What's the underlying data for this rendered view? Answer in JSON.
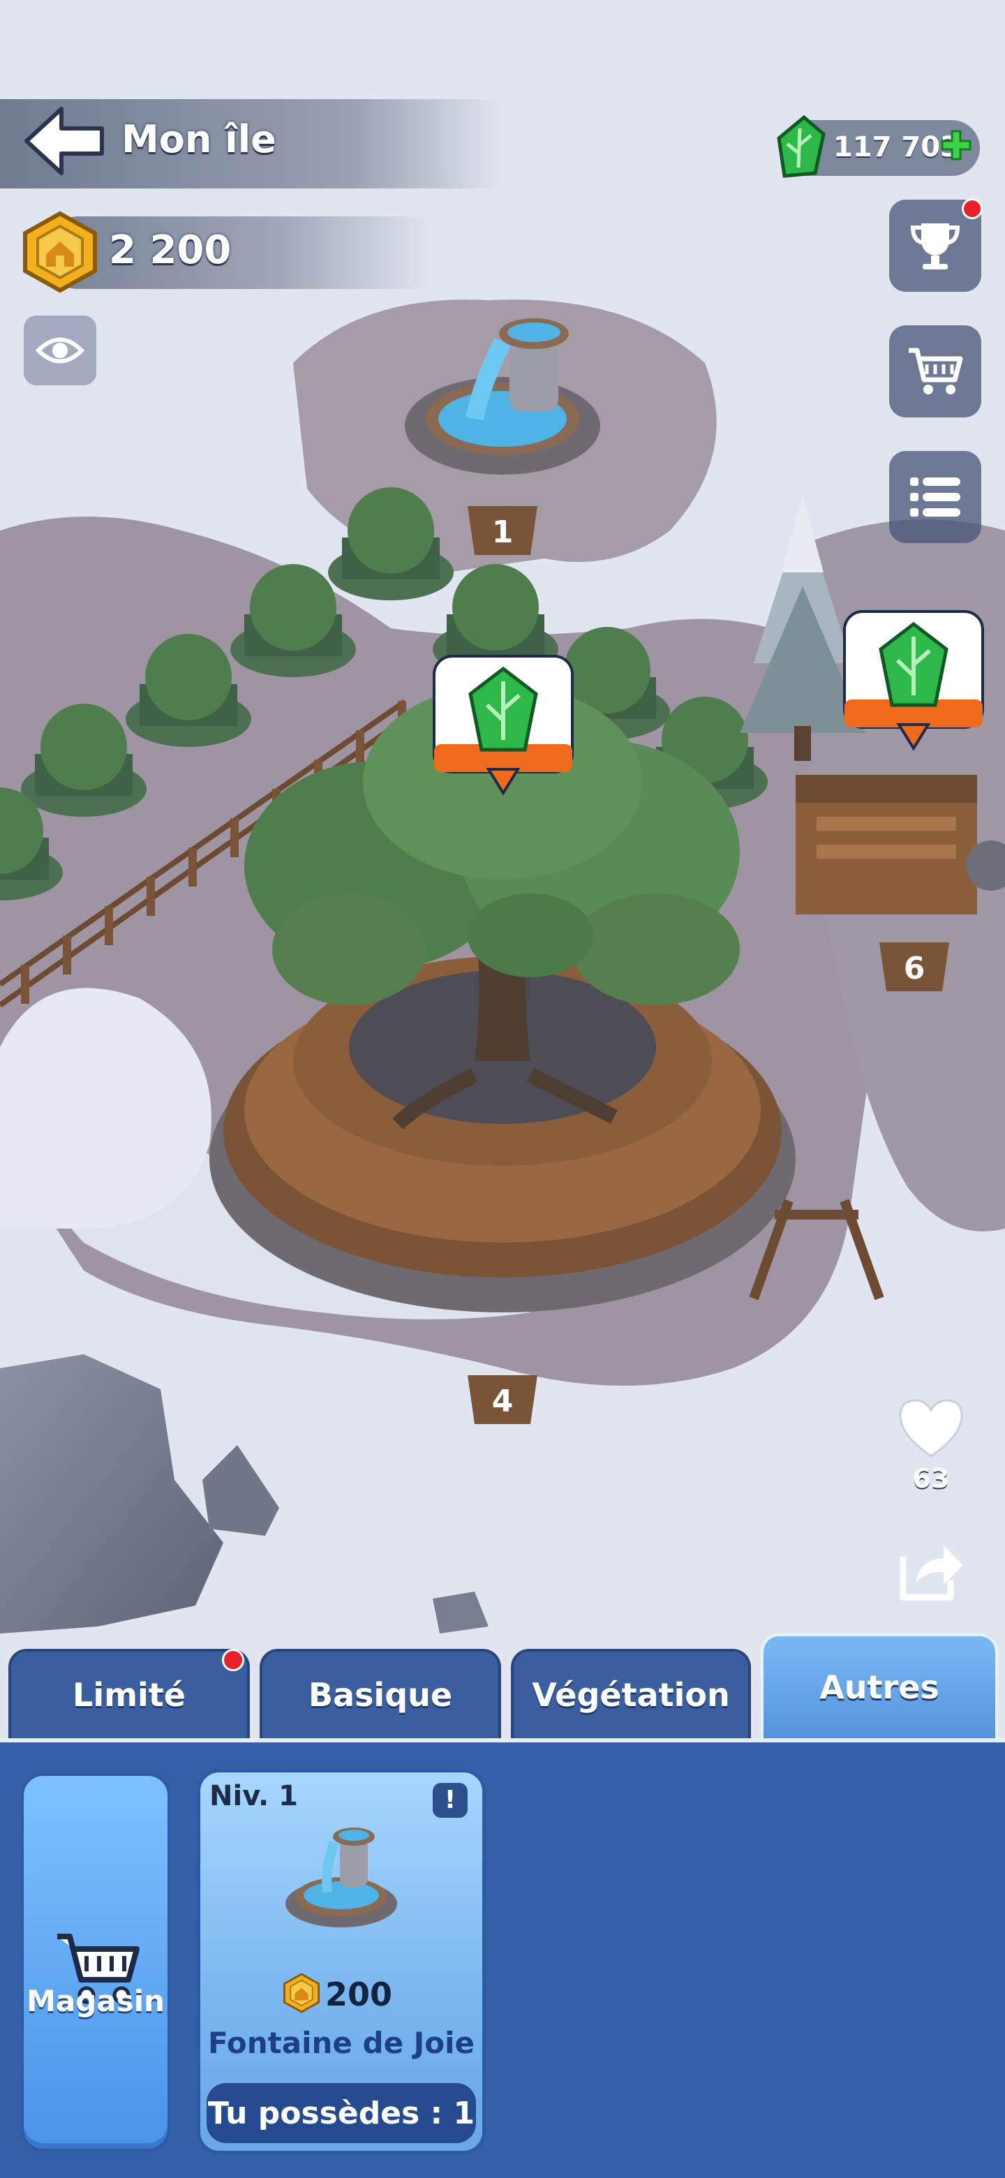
{
  "header": {
    "title": "Mon île",
    "back_icon": "back-arrow-icon"
  },
  "resources": {
    "coins": "2 200",
    "gems": "117 703",
    "gem_color": "#2fb84a",
    "coin_color": "#f2b01e"
  },
  "scene": {
    "plot_numbers": [
      "1",
      "6",
      "4"
    ],
    "like_count": "63"
  },
  "side_buttons": [
    "trophy-icon",
    "cart-icon",
    "list-icon"
  ],
  "tabs": [
    {
      "label": "Limité",
      "active": false,
      "notification": true
    },
    {
      "label": "Basique",
      "active": false,
      "notification": false
    },
    {
      "label": "Végétation",
      "active": false,
      "notification": false
    },
    {
      "label": "Autres",
      "active": true,
      "notification": false
    }
  ],
  "shop": {
    "label": "Magasin"
  },
  "item": {
    "level": "Niv. 1",
    "info": "!",
    "price": "200",
    "name": "Fontaine de Joie",
    "owned": "Tu possèdes : 1"
  },
  "colors": {
    "panel": "#3660a6",
    "tab_active": "#6aa8ee",
    "notification": "#e8212a"
  }
}
